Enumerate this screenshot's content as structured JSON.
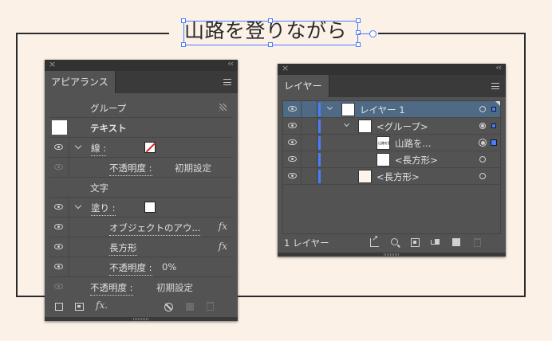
{
  "canvas": {
    "title_text": "山路を登りながら"
  },
  "appearance_panel": {
    "close_glyph": "×",
    "collapse_glyph": "‹‹",
    "tab_label": "アピアランス",
    "rows": {
      "group_label": "グループ",
      "text_label": "テキスト",
      "stroke_label": "線 :",
      "stroke_opacity_label": "不透明度 :",
      "stroke_opacity_value": "初期設定",
      "char_label": "文字",
      "fill_label": "塗り :",
      "object_outline_label": "オブジェクトのアウ...",
      "rect_label": "長方形",
      "fill_opacity_label": "不透明度 :",
      "fill_opacity_value": "0%",
      "opacity_label": "不透明度 :",
      "opacity_value": "初期設定"
    },
    "fx_glyph": "fx",
    "footer_fx": "fx."
  },
  "layers_panel": {
    "close_glyph": "×",
    "collapse_glyph": "‹‹",
    "tab_label": "レイヤー",
    "rows": [
      {
        "name": "レイヤー 1"
      },
      {
        "name": "<グループ>"
      },
      {
        "name": "山路を..."
      },
      {
        "name": "<長方形>"
      },
      {
        "name": "<長方形>"
      }
    ],
    "thumb_text": "山路を登りながら",
    "footer_count": "1 レイヤー"
  },
  "colors": {
    "selection_blue": "#4a7cff",
    "layer_color": "#4b7bff",
    "panel_bg": "#535353",
    "canvas_bg": "#fbf1e6"
  }
}
